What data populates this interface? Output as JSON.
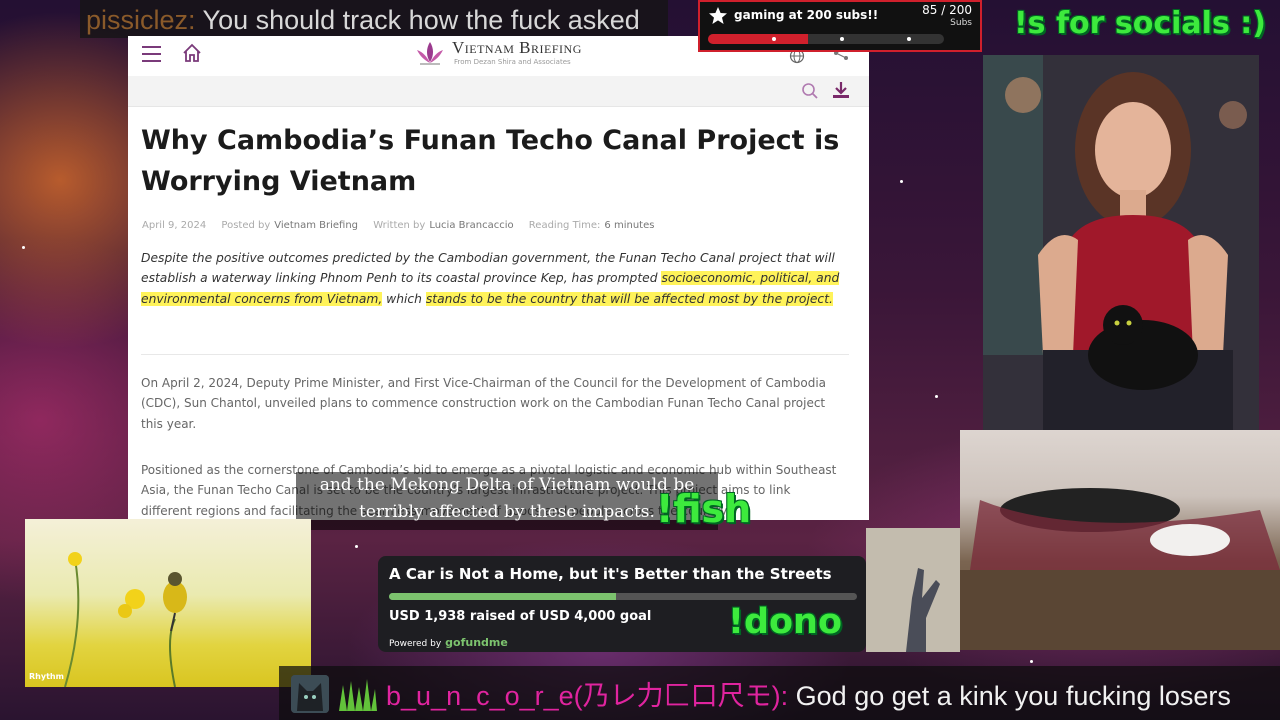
{
  "top_chat": {
    "username": "pissiclez:",
    "message": " You should track how the fuck asked"
  },
  "sub_goal": {
    "title": "gaming at 200 subs!!",
    "count": "85 / 200",
    "unit": "Subs",
    "progress": 0.425,
    "accent_color": "#d0202c"
  },
  "commands": {
    "socials": "!s for socials :)",
    "fish": "!fish",
    "dono": "!dono",
    "color": "#3dea3d"
  },
  "browser": {
    "site_name": "Vietnam Briefing",
    "site_tagline": "From Dezan Shira and Associates",
    "icons": [
      "menu-icon",
      "home-icon",
      "globe-icon",
      "share-icon",
      "search-icon",
      "download-icon"
    ],
    "article": {
      "title": "Why Cambodia’s Funan Techo Canal Project is Worrying Vietnam",
      "date": "April 9, 2024",
      "posted_by_label": "Posted by",
      "posted_by": "Vietnam Briefing",
      "written_by_label": "Written by",
      "written_by": "Lucia Brancaccio",
      "reading_time_label": "Reading Time:",
      "reading_time": "6 minutes",
      "lead_1": "Despite the positive outcomes predicted by the Cambodian government, the Funan Techo Canal project that will establish a waterway linking Phnom Penh to its coastal province Kep, has prompted ",
      "lead_hl_1": "socioeconomic, political, and environmental concerns from Vietnam,",
      "lead_2": " which ",
      "lead_hl_2": "stands to be the country that will be affected most by the project.",
      "paragraph_1": "On April 2, 2024, Deputy Prime Minister, and First Vice-Chairman of the Council for the Development of Cambodia (CDC), Sun Chantol, unveiled plans to commence construction work on the Cambodian Funan Techo Canal project this year.",
      "paragraph_2": "Positioned as the cornerstone of Cambodia’s bid to emerge as a pivotal logistic and economic hub within Southeast Asia, the Funan Techo Canal is set to be the country’s largest infrastructure project. This project aims to link different regions and facilitating the seamless movement of goods and people across the country.",
      "highlight_color": "#fff35a"
    }
  },
  "subtitle": {
    "line_1": "and the Mekong Delta of Vietnam would be",
    "line_2": "terribly affected by these impacts."
  },
  "nature_video": {
    "watermark": "Rhythm"
  },
  "gofundme": {
    "title": "A Car is Not a Home, but it's Better than the Streets",
    "raised_text": "USD 1,938 raised of USD 4,000 goal",
    "raised": 1938,
    "goal": 4000,
    "powered_by": "Powered by",
    "brand": "gofundme",
    "bar_color": "#7cc36e"
  },
  "bottom_chat": {
    "username": "b_u_n_c_o_r_e(乃レ力匚口尺モ):",
    "message": " God go get a kink you fucking losers",
    "username_color": "#e0249f"
  }
}
